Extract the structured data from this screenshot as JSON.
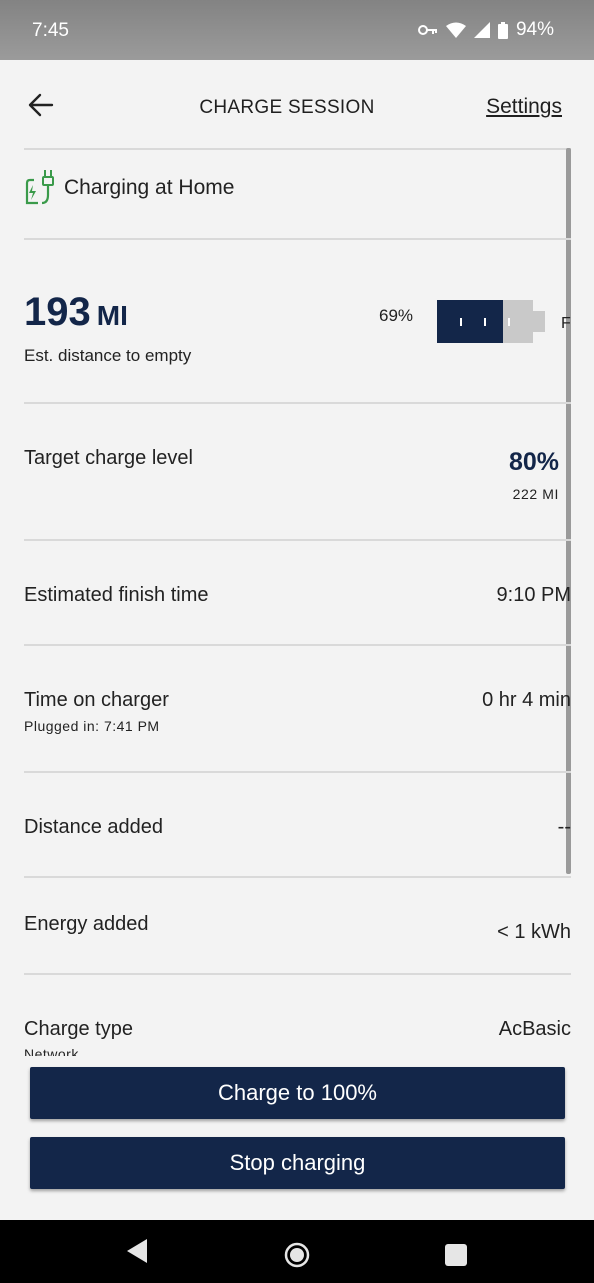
{
  "status_bar": {
    "time": "7:45",
    "battery_pct": "94%"
  },
  "header": {
    "title": "CHARGE SESSION",
    "settings_label": "Settings"
  },
  "charging_location": {
    "label": "Charging at Home"
  },
  "range": {
    "value": "193",
    "unit": "MI",
    "label": "Est. distance to empty",
    "battery_pct": "69%",
    "battery_level": 0.69,
    "full_marker": "F"
  },
  "target": {
    "label": "Target charge level",
    "pct": "80%",
    "distance": "222 MI"
  },
  "finish": {
    "label": "Estimated finish time",
    "value": "9:10 PM"
  },
  "time_on_charger": {
    "label": "Time on charger",
    "plugged": "Plugged in: 7:41 PM",
    "value": "0 hr 4 min"
  },
  "distance_added": {
    "label": "Distance added",
    "value": "--"
  },
  "energy_added": {
    "label": "Energy added",
    "value": "< 1 kWh"
  },
  "charge_type": {
    "label": "Charge type",
    "sublabel": "Network",
    "value": "AcBasic"
  },
  "buttons": {
    "charge_full": "Charge to 100%",
    "stop": "Stop charging"
  },
  "colors": {
    "accent": "#132649",
    "green_icon": "#3a9a4a",
    "background": "#f3f3f3"
  }
}
